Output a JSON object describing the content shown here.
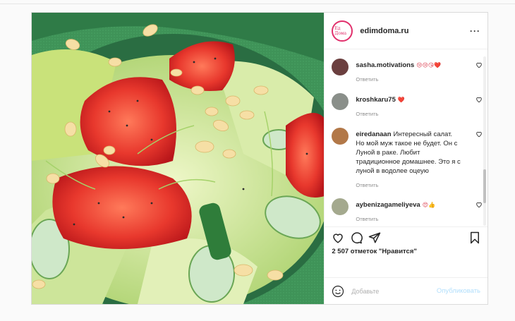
{
  "post": {
    "author": "edimdoma.ru",
    "author_avatar_text": "Ед Дома",
    "more_icon": "more-icon",
    "comments": [
      {
        "user": "sasha.motivations",
        "text": "😢😢😘❤️",
        "reply": "Ответить",
        "avatar_color": "#6b3f3f"
      },
      {
        "user": "kroshkaru75",
        "text": "❤️",
        "reply": "Ответить",
        "avatar_color": "#8a8f8a"
      },
      {
        "user": "eiredanaan",
        "text": "Интересный салат. Но мой муж такое не будет. Он с Луной в раке. Любит традиционное домашнее. Это я с луной в водолее оцеую",
        "reply": "Ответить",
        "avatar_color": "#b27848"
      },
      {
        "user": "aybenizagameliyeva",
        "text": "😍👍",
        "reply": "Ответить",
        "avatar_color": "#a4a98e"
      }
    ],
    "likes": "2 507 отметок \"Нравится\"",
    "add_comment_placeholder": "Добавьте",
    "publish_label": "Опубликовать",
    "colors": {
      "accent": "#0095f6",
      "publish_disabled": "#b2dffc",
      "heart": "#ed4956"
    }
  }
}
